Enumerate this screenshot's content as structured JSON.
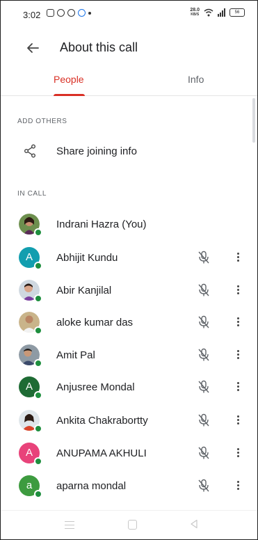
{
  "status_bar": {
    "time": "3:02",
    "speed_value": "28.0",
    "speed_unit": "KB/S",
    "battery": "56"
  },
  "app_bar": {
    "title": "About this call"
  },
  "tabs": [
    {
      "label": "People",
      "active": true
    },
    {
      "label": "Info",
      "active": false
    }
  ],
  "sections": {
    "add_others": "ADD OTHERS",
    "in_call": "IN CALL"
  },
  "share": {
    "label": "Share joining info",
    "icon": "share-icon"
  },
  "participants": [
    {
      "name": "Indrani Hazra (You)",
      "avatar": "photo",
      "show_controls": false
    },
    {
      "name": "Abhijit Kundu",
      "avatar": "letter",
      "letter": "A",
      "color": "#129eaf",
      "show_controls": true
    },
    {
      "name": "Abir Kanjilal",
      "avatar": "photo",
      "show_controls": true
    },
    {
      "name": "aloke kumar das",
      "avatar": "photo",
      "show_controls": true
    },
    {
      "name": "Amit Pal",
      "avatar": "photo",
      "show_controls": true
    },
    {
      "name": "Anjusree Mondal",
      "avatar": "letter",
      "letter": "A",
      "color": "#1e6b34",
      "show_controls": true
    },
    {
      "name": "Ankita Chakrabortty",
      "avatar": "photo",
      "show_controls": true
    },
    {
      "name": "ANUPAMA AKHULI",
      "avatar": "letter",
      "letter": "A",
      "color": "#e8437a",
      "show_controls": true
    },
    {
      "name": "aparna mondal",
      "avatar": "letter",
      "letter": "a",
      "color": "#3d9b3f",
      "show_controls": true
    }
  ],
  "colors": {
    "accent": "#d93025",
    "online": "#1e8e3e"
  }
}
